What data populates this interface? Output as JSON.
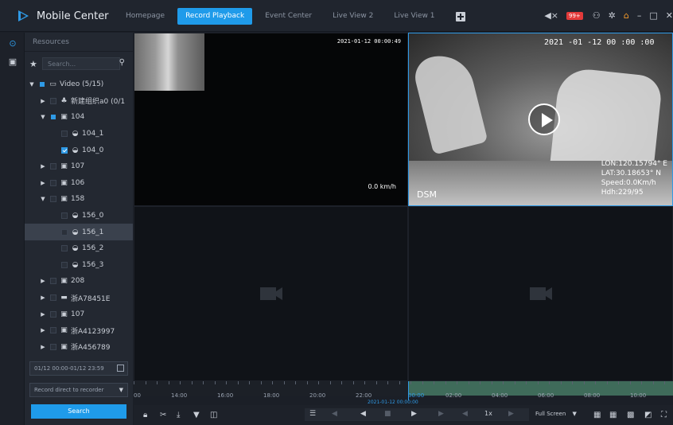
{
  "app": {
    "title": "Mobile Center"
  },
  "tabs": [
    {
      "label": "Homepage",
      "active": false
    },
    {
      "label": "Record Playback",
      "active": true
    },
    {
      "label": "Event Center",
      "active": false
    },
    {
      "label": "Live View 2",
      "active": false
    },
    {
      "label": "Live View 1",
      "active": false
    }
  ],
  "titlebar": {
    "alarm_count": "99+"
  },
  "sidebar": {
    "title": "Resources",
    "search_placeholder": "Search..."
  },
  "tree": [
    {
      "label": "Video (5/15)",
      "level": 0,
      "expand": "open",
      "check": "partial",
      "icon": "video-group-icon"
    },
    {
      "label": "新建组织a0 (0/1",
      "level": 1,
      "expand": "closed",
      "check": "none",
      "icon": "org-icon"
    },
    {
      "label": "104",
      "level": 1,
      "expand": "open",
      "check": "partial",
      "icon": "device-icon"
    },
    {
      "label": "104_1",
      "level": 2,
      "expand": "",
      "check": "none",
      "icon": "camera-icon"
    },
    {
      "label": "104_0",
      "level": 2,
      "expand": "",
      "check": "checked",
      "icon": "camera-icon"
    },
    {
      "label": "107",
      "level": 1,
      "expand": "closed",
      "check": "none",
      "icon": "device-icon"
    },
    {
      "label": "106",
      "level": 1,
      "expand": "closed",
      "check": "none",
      "icon": "device-icon"
    },
    {
      "label": "158",
      "level": 1,
      "expand": "open",
      "check": "none",
      "icon": "device-icon"
    },
    {
      "label": "156_0",
      "level": 2,
      "expand": "",
      "check": "none",
      "icon": "camera-icon"
    },
    {
      "label": "156_1",
      "level": 2,
      "expand": "",
      "check": "none",
      "icon": "camera-icon",
      "selected": true
    },
    {
      "label": "156_2",
      "level": 2,
      "expand": "",
      "check": "none",
      "icon": "camera-icon"
    },
    {
      "label": "156_3",
      "level": 2,
      "expand": "",
      "check": "none",
      "icon": "camera-icon"
    },
    {
      "label": "208",
      "level": 1,
      "expand": "closed",
      "check": "none",
      "icon": "device-icon"
    },
    {
      "label": "浙A78451E",
      "level": 1,
      "expand": "closed",
      "check": "none",
      "icon": "vehicle-icon"
    },
    {
      "label": "107",
      "level": 1,
      "expand": "closed",
      "check": "none",
      "icon": "device-icon"
    },
    {
      "label": "浙A4123997",
      "level": 1,
      "expand": "closed",
      "check": "none",
      "icon": "device-icon"
    },
    {
      "label": "浙A456789",
      "level": 1,
      "expand": "closed",
      "check": "none",
      "icon": "device-icon"
    }
  ],
  "filters": {
    "time_range": "01/12 00:00-01/12 23:59",
    "record_source": "Record direct to recorder",
    "search_button": "Search"
  },
  "cells": {
    "cell1_timestamp": "2021-01-12 00:00:49",
    "cell1_speed": "0.0 km/h",
    "cell2_timestamp": "2021 -01 -12 00 :00 :00",
    "cell2_overlay_label": "DSM",
    "cell2_gps": [
      "LON:120.15794° E",
      "LAT:30.18653° N",
      "Speed:0.0Km/h",
      "Hdh:229/95"
    ]
  },
  "timeline": {
    "labels": [
      "00",
      "14:00",
      "16:00",
      "18:00",
      "20:00",
      "22:00",
      "00:00",
      "02:00",
      "04:00",
      "06:00",
      "08:00",
      "10:00"
    ],
    "cursor_time": "2021-01-12 00:00:00"
  },
  "playback": {
    "speed": "1x",
    "view_mode": "Full Screen"
  },
  "colors": {
    "accent": "#1f9bea",
    "background": "#1b1f27",
    "record_band": "#3f6b5a"
  }
}
